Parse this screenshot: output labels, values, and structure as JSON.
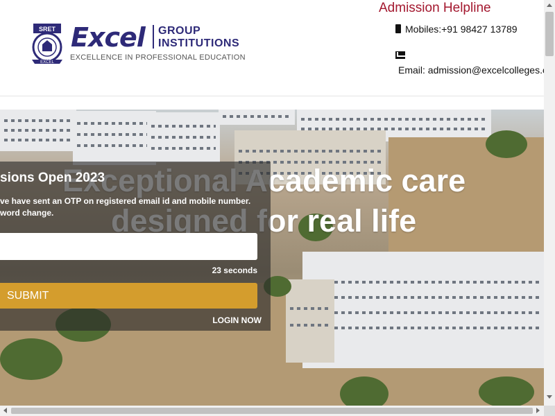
{
  "header": {
    "logo": {
      "seal_text_top": "SRET",
      "seal_text_bottom": "EXCEL",
      "wordmark": "Excel",
      "group_line1": "GROUP",
      "group_line2": "INSTITUTIONS",
      "tagline": "EXCELLENCE IN PROFESSIONAL EDUCATION"
    },
    "helpline": {
      "title": "Admission Helpline",
      "mobile_icon": "mobile-phone-icon",
      "mobile_text": "Mobiles:+91 98427 13789",
      "email_icon": "envelope-icon",
      "email_text": "Email: admission@excelcolleges.com"
    }
  },
  "hero": {
    "title_line1": "Exceptional Academic care",
    "title_line2": "designed for real life"
  },
  "panel": {
    "title": "sions Open 2023",
    "message": "ve have sent an OTP on registered email id and mobile number. word change.",
    "otp_value": "",
    "timer": "23 seconds",
    "submit_label": "SUBMIT",
    "login_link": "LOGIN NOW"
  },
  "colors": {
    "brand_blue": "#2e2a78",
    "helpline_red": "#a3172e",
    "submit_gold": "#d49d2d"
  }
}
